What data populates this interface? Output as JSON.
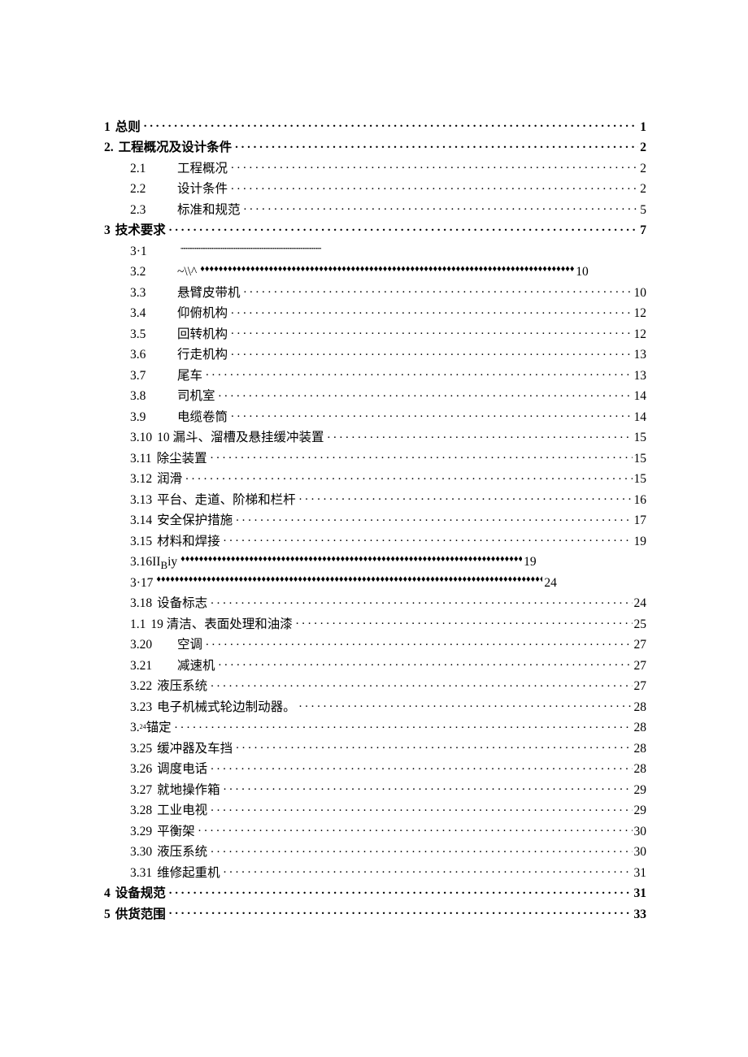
{
  "toc": [
    {
      "indent": 0,
      "num": "1",
      "title": "总则",
      "leader": "dots",
      "page": "1",
      "bold": true,
      "numStyle": "tight"
    },
    {
      "indent": 0,
      "num": "2.",
      "title": "工程概况及设计条件",
      "leader": "dots",
      "page": "2",
      "bold": true,
      "numStyle": "tight"
    },
    {
      "indent": 1,
      "num": "2.1",
      "title": "工程概况",
      "leader": "dots",
      "page": "2",
      "numStyle": "wide"
    },
    {
      "indent": 1,
      "num": "2.2",
      "title": "设计条件",
      "leader": "dots",
      "page": "2",
      "numStyle": "wide"
    },
    {
      "indent": 1,
      "num": "2.3",
      "title": "标准和规范",
      "leader": "dots",
      "page": "5",
      "numStyle": "wide"
    },
    {
      "indent": 0,
      "num": "3",
      "title": "技术要求",
      "leader": "dots",
      "page": "7",
      "bold": true,
      "numStyle": "tight"
    },
    {
      "indent": 1,
      "num": "3·1",
      "title": "",
      "leader": "tinydots",
      "page": "",
      "numStyle": "wide",
      "short": true
    },
    {
      "indent": 1,
      "num": "3.2",
      "title": "~\\\\^",
      "leader": "diamonds",
      "page": "10",
      "numStyle": "wide",
      "short2": true
    },
    {
      "indent": 1,
      "num": "3.3",
      "title": "悬臂皮带机",
      "leader": "dots",
      "page": "10",
      "numStyle": "wide"
    },
    {
      "indent": 1,
      "num": "3.4",
      "title": "仰俯机构",
      "leader": "dots",
      "page": "12",
      "numStyle": "wide"
    },
    {
      "indent": 1,
      "num": "3.5",
      "title": "回转机构",
      "leader": "dots",
      "page": "12",
      "numStyle": "wide"
    },
    {
      "indent": 1,
      "num": "3.6",
      "title": "行走机构",
      "leader": "dots",
      "page": "13",
      "numStyle": "wide"
    },
    {
      "indent": 1,
      "num": "3.7",
      "title": "尾车",
      "leader": "dots",
      "page": "13",
      "numStyle": "wide"
    },
    {
      "indent": 1,
      "num": "3.8",
      "title": "司机室",
      "leader": "dots",
      "page": "14",
      "numStyle": "wide"
    },
    {
      "indent": 1,
      "num": "3.9",
      "title": "电缆卷筒",
      "leader": "dots",
      "page": "14",
      "numStyle": "wide"
    },
    {
      "indent": 1,
      "num": "3.10",
      "title": "10 漏斗、溜槽及悬挂缓冲装置",
      "leader": "dots",
      "page": "15",
      "numStyle": "tight"
    },
    {
      "indent": 1,
      "num": "3.11",
      "title": "除尘装置",
      "leader": "dots",
      "page": "15",
      "numStyle": "tight"
    },
    {
      "indent": 1,
      "num": "3.12",
      "title": "润滑",
      "leader": "dots",
      "page": "15",
      "numStyle": "tight"
    },
    {
      "indent": 1,
      "num": "3.13",
      "title": "平台、走道、阶梯和栏杆",
      "leader": "dots",
      "page": "16",
      "numStyle": "tight"
    },
    {
      "indent": 1,
      "num": "3.14",
      "title": "安全保护措施",
      "leader": "dots",
      "page": "17",
      "numStyle": "tight"
    },
    {
      "indent": 1,
      "num": "3.15",
      "title": "材料和焊接",
      "leader": "dots",
      "page": "19",
      "numStyle": "tight"
    },
    {
      "indent": 1,
      "num": "",
      "title": "3.16II<sub>B</sub>iy",
      "leader": "diamonds",
      "page": "19",
      "short3": true,
      "raw": true
    },
    {
      "indent": 1,
      "num": "",
      "title": "3·17",
      "leader": "diamonds",
      "page": "24",
      "short4": true
    },
    {
      "indent": 1,
      "num": "3.18",
      "title": "设备标志",
      "leader": "dots",
      "page": "24",
      "numStyle": "tight"
    },
    {
      "indent": 1,
      "num": "1.1",
      "title": "19 清洁、表面处理和油漆",
      "leader": "dots",
      "page": "25",
      "numStyle": "tight"
    },
    {
      "indent": 1,
      "num": "3.20",
      "title": "空调",
      "leader": "dots",
      "page": "27",
      "numStyle": "wide"
    },
    {
      "indent": 1,
      "num": "3.21",
      "title": "减速机",
      "leader": "dots",
      "page": "27",
      "numStyle": "wide"
    },
    {
      "indent": 1,
      "num": "3.22",
      "title": "液压系统",
      "leader": "dots",
      "page": "27",
      "numStyle": "tight"
    },
    {
      "indent": 1,
      "num": "3.23",
      "title": "电子机械式轮边制动器。",
      "leader": "dots",
      "page": "28",
      "numStyle": "tight"
    },
    {
      "indent": 1,
      "num": "3.",
      "title_prefix_tiny": "24",
      "title": "锚定",
      "leader": "dots",
      "page": "28",
      "numStyle": "none"
    },
    {
      "indent": 1,
      "num": "3.25",
      "title": "缓冲器及车挡",
      "leader": "dots",
      "page": "28",
      "numStyle": "tight"
    },
    {
      "indent": 1,
      "num": "3.26",
      "title": "调度电话",
      "leader": "dots",
      "page": "28",
      "numStyle": "tight"
    },
    {
      "indent": 1,
      "num": "3.27",
      "title": "就地操作箱",
      "leader": "dots",
      "page": "29",
      "numStyle": "tight"
    },
    {
      "indent": 1,
      "num": "3.28",
      "title": "工业电视",
      "leader": "dots",
      "page": "29",
      "numStyle": "tight"
    },
    {
      "indent": 1,
      "num": "3.29",
      "title": "平衡架",
      "leader": "dots",
      "page": "30",
      "numStyle": "tight"
    },
    {
      "indent": 1,
      "num": "3.30",
      "title": "液压系统",
      "leader": "dots",
      "page": "30",
      "numStyle": "tight"
    },
    {
      "indent": 1,
      "num": "3.31",
      "title": "维修起重机",
      "leader": "dots",
      "page": "31",
      "numStyle": "tight"
    },
    {
      "indent": 0,
      "num": "4",
      "title": "设备规范",
      "leader": "dots",
      "page": "31",
      "bold": true,
      "numStyle": "tight"
    },
    {
      "indent": 0,
      "num": "5",
      "title": "供货范围",
      "leader": "dots",
      "page": "33",
      "bold": true,
      "numStyle": "tight"
    }
  ]
}
